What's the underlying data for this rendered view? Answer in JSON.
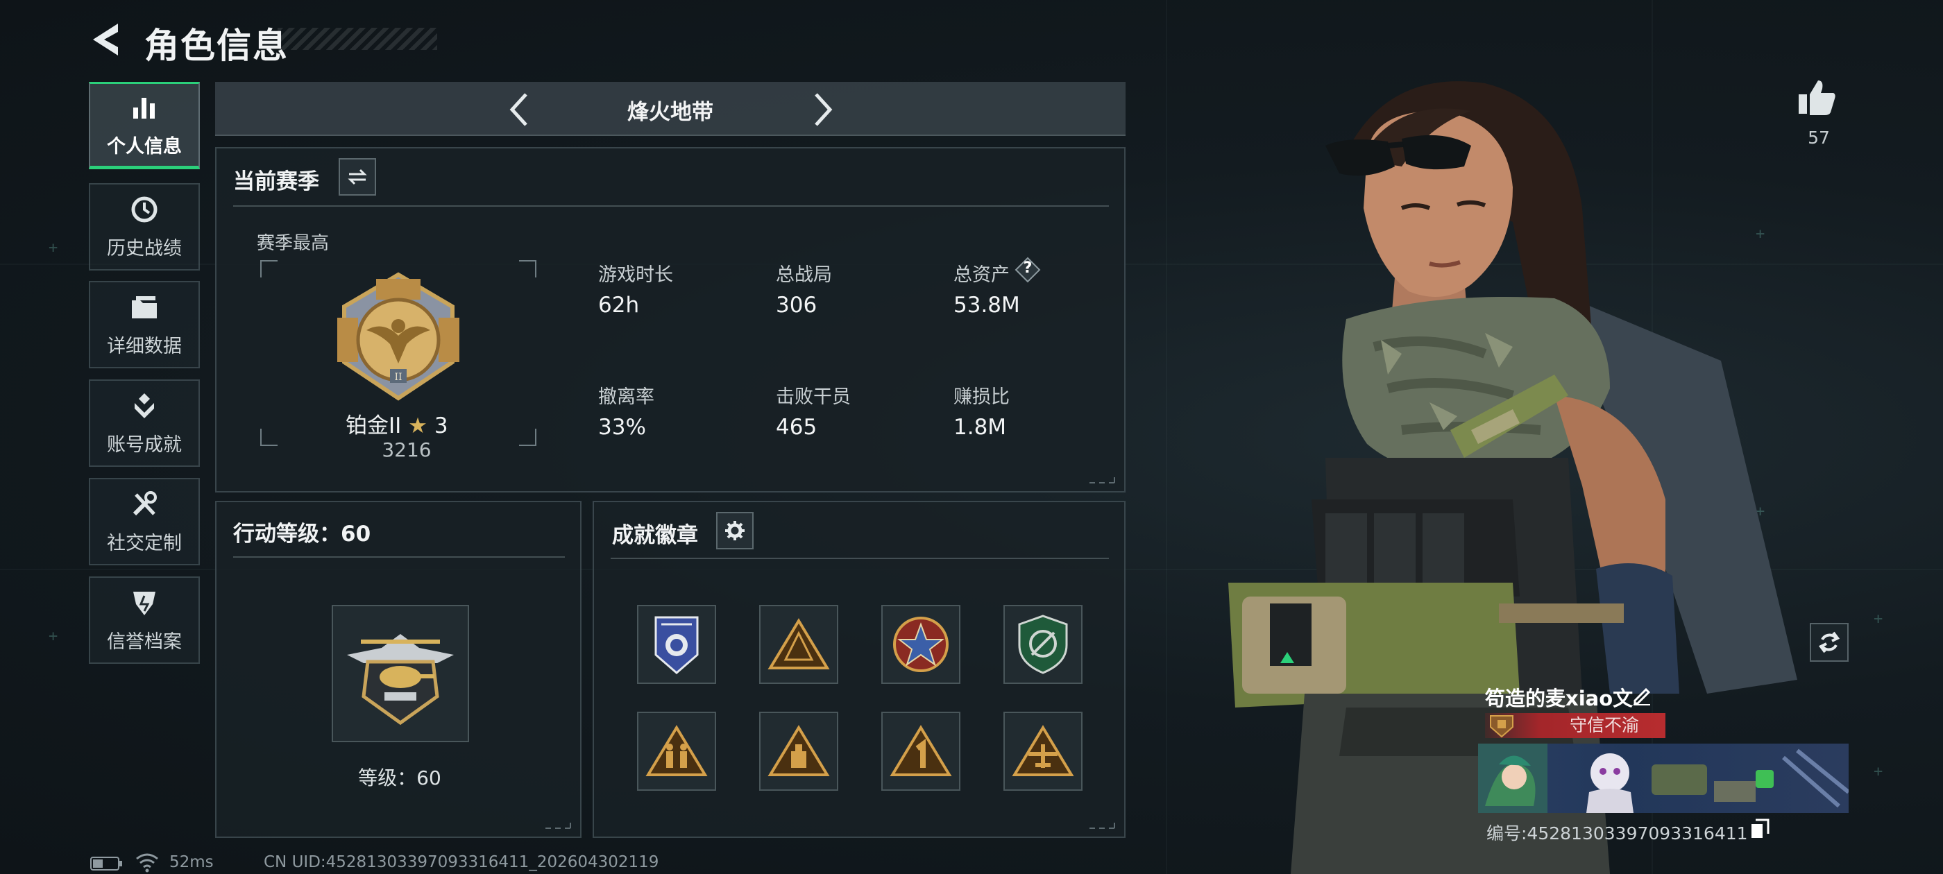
{
  "header": {
    "title": "角色信息"
  },
  "sidebar": {
    "items": [
      {
        "label": "个人信息",
        "icon": "bar-chart-icon",
        "active": true
      },
      {
        "label": "历史战绩",
        "icon": "clock-icon",
        "active": false
      },
      {
        "label": "详细数据",
        "icon": "folder-icon",
        "active": false
      },
      {
        "label": "账号成就",
        "icon": "medal-icon",
        "active": false
      },
      {
        "label": "社交定制",
        "icon": "tools-icon",
        "active": false
      },
      {
        "label": "信誉档案",
        "icon": "shield-icon",
        "active": false
      }
    ]
  },
  "mode": {
    "title": "烽火地带"
  },
  "season": {
    "heading": "当前赛季",
    "best_label": "赛季最高",
    "rank_name": "铂金II",
    "rank_stars": "3",
    "rank_score": "3216",
    "stats": [
      {
        "label": "游戏时长",
        "value": "62h"
      },
      {
        "label": "总战局",
        "value": "306"
      },
      {
        "label": "总资产",
        "value": "53.8M"
      },
      {
        "label": "撤离率",
        "value": "33%"
      },
      {
        "label": "击败干员",
        "value": "465"
      },
      {
        "label": "赚损比",
        "value": "1.8M"
      }
    ],
    "help_glyph": "?"
  },
  "action_level": {
    "heading": "行动等级：60",
    "level_text": "等级：60"
  },
  "achievements": {
    "heading": "成就徽章",
    "badges": [
      "police-badge-icon",
      "triangle-emblem-icon",
      "star-seal-icon",
      "green-shield-icon",
      "soldiers-triangle-icon",
      "bottle-triangle-icon",
      "number-one-triangle-icon",
      "plane-triangle-icon"
    ]
  },
  "profile": {
    "likes": "57",
    "player_name": "笱造的麦xiao文",
    "title": "守信不渝",
    "id_text": "编号:4528130339709331641​1"
  },
  "status": {
    "ping": "52ms",
    "uid": "CN UID:452813033970933164​11_202604302119"
  },
  "colors": {
    "accent_green": "#2bd07a",
    "title_red": "#b72c2f",
    "gold": "#c9a45a"
  }
}
